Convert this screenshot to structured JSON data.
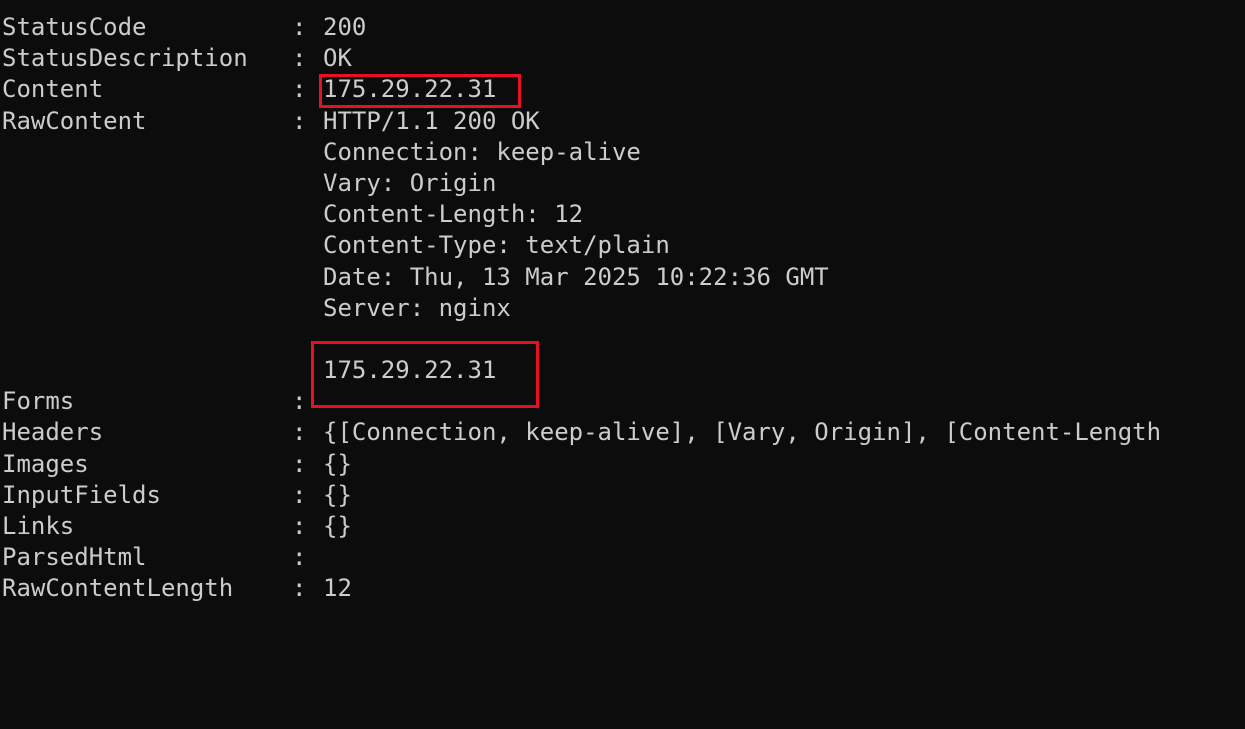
{
  "rows": [
    {
      "label": "StatusCode",
      "sep": ":",
      "value": "200"
    },
    {
      "label": "StatusDescription",
      "sep": ":",
      "value": "OK"
    },
    {
      "label": "Content",
      "sep": ":",
      "value": "175.29.22.31"
    },
    {
      "label": "RawContent",
      "sep": ":",
      "value": "HTTP/1.1 200 OK"
    },
    {
      "label": "",
      "sep": "",
      "value": "Connection: keep-alive"
    },
    {
      "label": "",
      "sep": "",
      "value": "Vary: Origin"
    },
    {
      "label": "",
      "sep": "",
      "value": "Content-Length: 12"
    },
    {
      "label": "",
      "sep": "",
      "value": "Content-Type: text/plain"
    },
    {
      "label": "",
      "sep": "",
      "value": "Date: Thu, 13 Mar 2025 10:22:36 GMT"
    },
    {
      "label": "",
      "sep": "",
      "value": "Server: nginx"
    },
    {
      "label": "",
      "sep": "",
      "value": ""
    },
    {
      "label": "",
      "sep": "",
      "value": "175.29.22.31"
    },
    {
      "label": "Forms",
      "sep": ":",
      "value": ""
    },
    {
      "label": "Headers",
      "sep": ":",
      "value": "{[Connection, keep-alive], [Vary, Origin], [Content-Length"
    },
    {
      "label": "Images",
      "sep": ":",
      "value": "{}"
    },
    {
      "label": "InputFields",
      "sep": ":",
      "value": "{}"
    },
    {
      "label": "Links",
      "sep": ":",
      "value": "{}"
    },
    {
      "label": "ParsedHtml",
      "sep": ":",
      "value": ""
    },
    {
      "label": "RawContentLength",
      "sep": ":",
      "value": "12"
    }
  ],
  "colors": {
    "background": "#0c0c0c",
    "text": "#cccccc",
    "highlight": "#e81123"
  }
}
